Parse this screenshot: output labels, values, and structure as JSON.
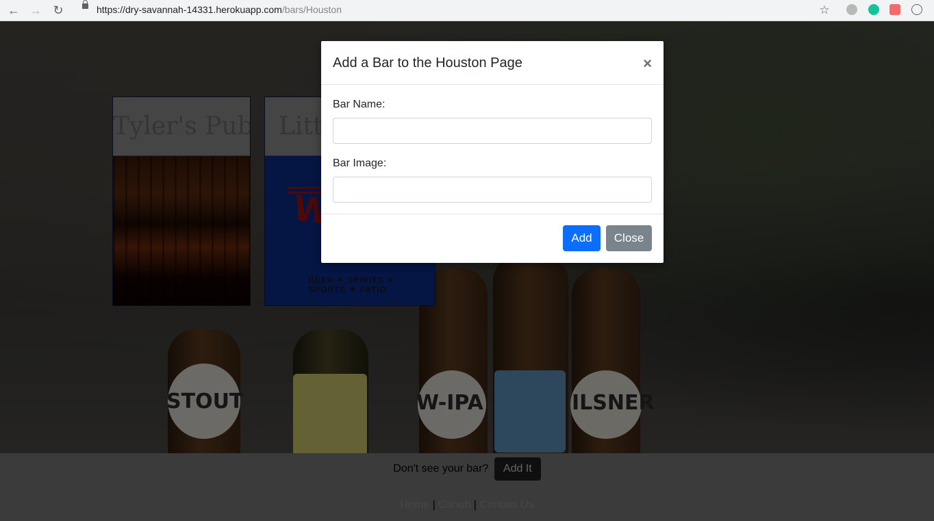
{
  "browser": {
    "url_domain": "https://dry-savannah-14331.herokuapp.com",
    "url_path": "/bars/Houston"
  },
  "cards": [
    {
      "title": "Tyler's Pub"
    },
    {
      "title": "Little"
    }
  ],
  "woodrows": {
    "logo": "WOODROWS",
    "tagline": "BEER ✶ SPIRITS ✶ SPORTS ✶ PATIO"
  },
  "bottles": [
    "STOUT",
    "W-IPA",
    "ILSNER"
  ],
  "modal": {
    "title": "Add a Bar to the Houston Page",
    "close_symbol": "×",
    "bar_name_label": "Bar Name:",
    "bar_image_label": "Bar Image:",
    "add_label": "Add",
    "close_label": "Close"
  },
  "footer": {
    "prompt": "Don't see your bar?",
    "add_it_label": "Add It",
    "links": [
      "Home",
      "Github",
      "Contact Us"
    ],
    "separator": " | "
  }
}
